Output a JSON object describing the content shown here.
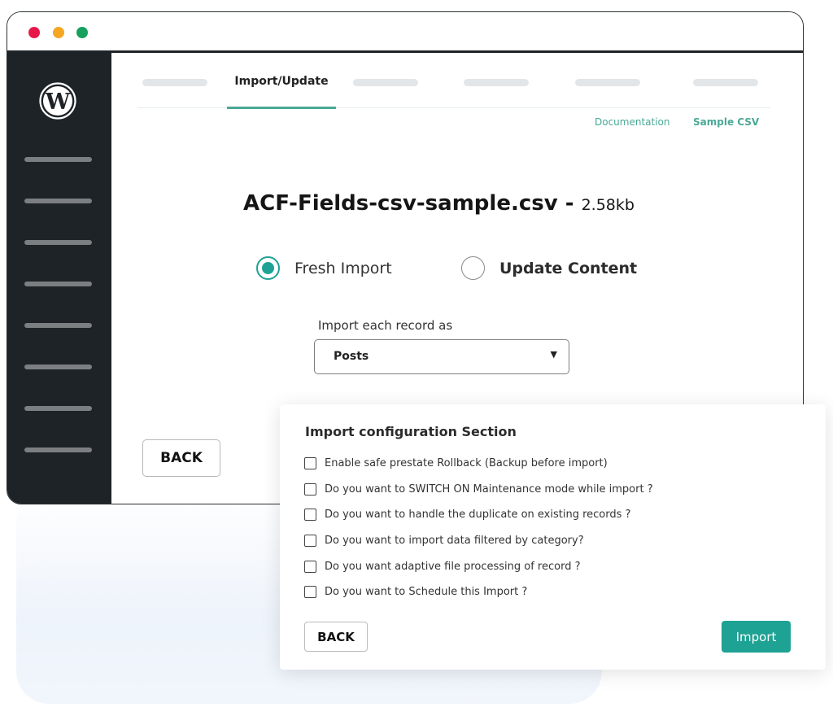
{
  "window": {
    "colors": {
      "close": "#e8174a",
      "minimize": "#f5a623",
      "maximize": "#16a05e",
      "sidebar": "#1e2328",
      "accent": "#1ea294"
    }
  },
  "sidebar": {
    "logo_icon": "wordpress-icon",
    "placeholder_items": 8
  },
  "tabs": {
    "active_label": "Import/Update",
    "placeholder_tabs": 5
  },
  "links": {
    "documentation": "Documentation",
    "sample_csv": "Sample CSV"
  },
  "file": {
    "name": "ACF-Fields-csv-sample.csv -",
    "size": "2.58kb"
  },
  "import_mode": {
    "options": [
      {
        "label": "Fresh Import",
        "selected": true
      },
      {
        "label": "Update Content",
        "selected": false
      }
    ]
  },
  "record_type": {
    "label": "Import each record as",
    "selected": "Posts"
  },
  "main_back_label": "BACK",
  "config": {
    "title": "Import configuration Section",
    "options": [
      {
        "label": "Enable safe prestate Rollback (Backup before import)",
        "checked": false
      },
      {
        "label": "Do you want to SWITCH ON Maintenance mode while import ?",
        "checked": false
      },
      {
        "label": "Do you want to handle the duplicate on existing records ?",
        "checked": false
      },
      {
        "label": "Do you want to import data filtered by category?",
        "checked": false
      },
      {
        "label": "Do you want adaptive file processing of record ?",
        "checked": false
      },
      {
        "label": "Do you want to Schedule this Import ?",
        "checked": false
      }
    ],
    "back_label": "BACK",
    "import_label": "Import"
  }
}
